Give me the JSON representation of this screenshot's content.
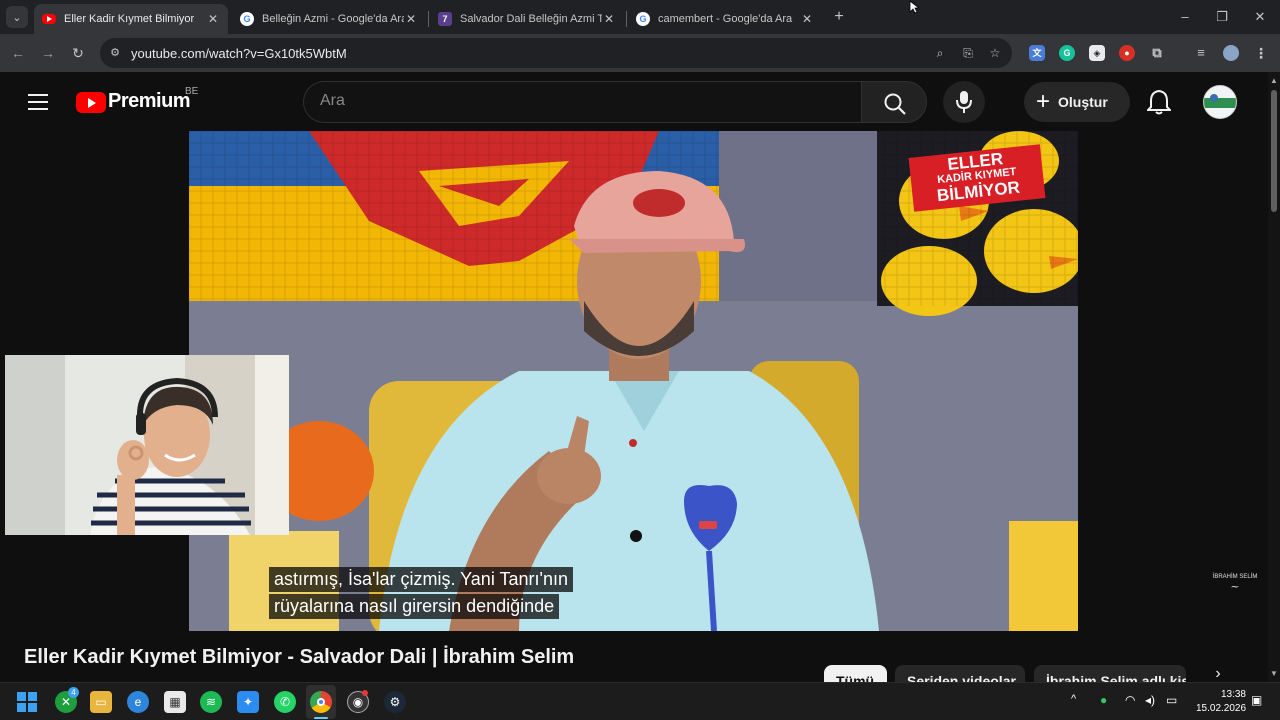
{
  "browser": {
    "tabs": [
      {
        "title": "Eller Kadir Kıymet Bilmiyor",
        "active": true,
        "favicon": "youtube-icon"
      },
      {
        "title": "Belleğin Azmi - Google'da Ara",
        "active": false,
        "favicon": "google-icon"
      },
      {
        "title": "Salvador Dali Belleğin Azmi Tab",
        "active": false,
        "favicon": "site-icon"
      },
      {
        "title": "camembert - Google'da Ara",
        "active": false,
        "favicon": "google-icon"
      }
    ],
    "url": "youtube.com/watch?v=Gx10tk5WbtM"
  },
  "youtube": {
    "logo_text": "Premium",
    "region": "BE",
    "search_placeholder": "Ara",
    "create_label": "Oluştur"
  },
  "video": {
    "overlay_badge": [
      "ELLER",
      "KADİR KIYMET",
      "BİLMİYOR"
    ],
    "cap_line1": "astırmış, İsa'lar çizmiş. Yani Tanrı'nın",
    "cap_line2": "rüyalarına nasıl girersin dendiğinde",
    "cap_line3": "",
    "cap_line4": "",
    "watermark": "İBRAHİM SELİM",
    "title": "Eller Kadir Kıymet Bilmiyor - Salvador Dali | İbrahim Selim"
  },
  "chips": [
    "Tümü",
    "Seriden videolar",
    "İbrahim Selim adlı kişi"
  ],
  "taskbar": {
    "time": "13:38",
    "date": "15.02.2026",
    "xbox_badge": "4"
  },
  "colors": {
    "yt_red": "#ff0000",
    "bg": "#0f0f0f",
    "chrome_dark": "#202124",
    "chrome_mid": "#35363a"
  }
}
